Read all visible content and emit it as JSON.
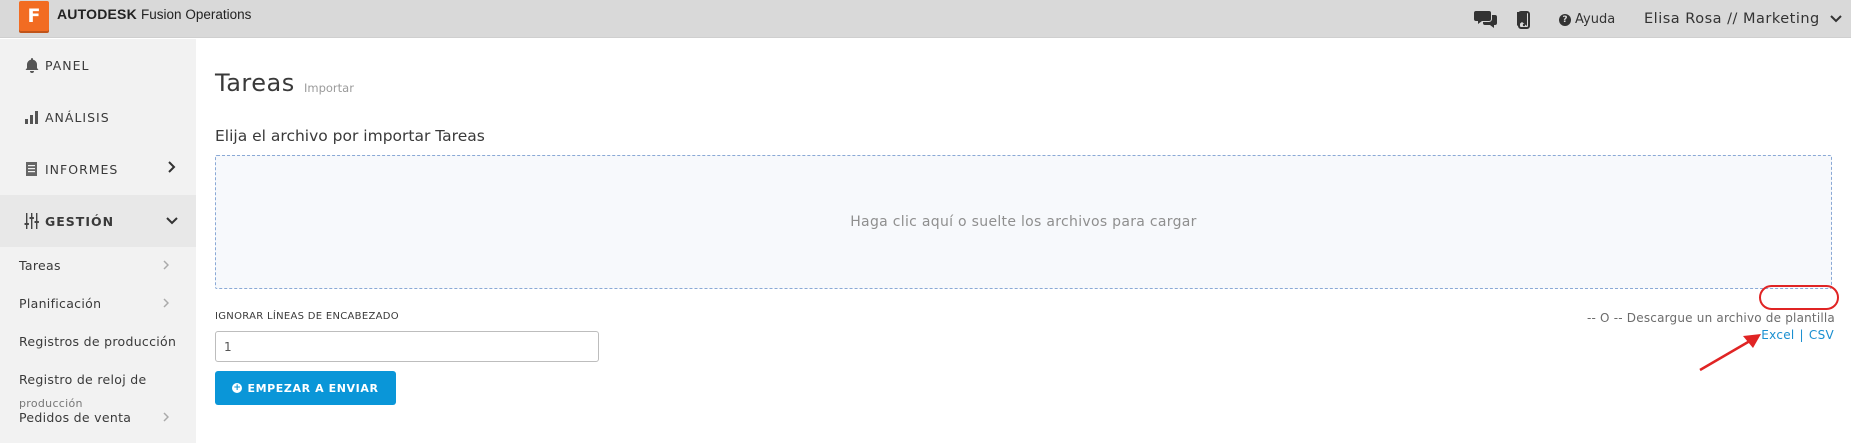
{
  "header": {
    "logo_letter": "F",
    "brand_bold": "AUTODESK",
    "brand_product": "Fusion Operations",
    "help_label": "Ayuda",
    "user_label": "Elisa Rosa // Marketing",
    "icons": [
      "chat-icon",
      "mobile-icon",
      "bookmark-icon",
      "help-icon",
      "chevron-down-icon"
    ]
  },
  "sidebar": {
    "items": [
      {
        "label": "PANEL",
        "icon": "bell-icon"
      },
      {
        "label": "ANÁLISIS",
        "icon": "bar-chart-icon"
      },
      {
        "label": "INFORMES",
        "icon": "document-icon"
      },
      {
        "label": "GESTIÓN",
        "icon": "sliders-icon"
      }
    ],
    "sub_items": [
      {
        "label": "Tareas"
      },
      {
        "label": "Planificación"
      },
      {
        "label": "Registros de producción"
      },
      {
        "label": "Registro de reloj de"
      },
      {
        "label_top": "producción",
        "label": "Pedidos de venta"
      }
    ]
  },
  "main": {
    "title": "Tareas",
    "subtitle": "Importar",
    "section_title": "Elija el archivo por importar Tareas",
    "dropzone_text": "Haga clic aquí o suelte los archivos para cargar",
    "header_lines_label": "IGNORAR LÍNEAS DE ENCABEZADO",
    "header_lines_value": "1",
    "start_button": "EMPEZAR A ENVIAR",
    "template_text": "-- O -- Descargue un archivo de plantilla",
    "template_excel": "Excel",
    "template_separator": "|",
    "template_csv": "CSV"
  },
  "colors": {
    "topbar": "#d9d9d9",
    "logo": "#f26c22",
    "accent": "#0a96d8",
    "link": "#1a8fd0",
    "annotation": "#e02424"
  }
}
